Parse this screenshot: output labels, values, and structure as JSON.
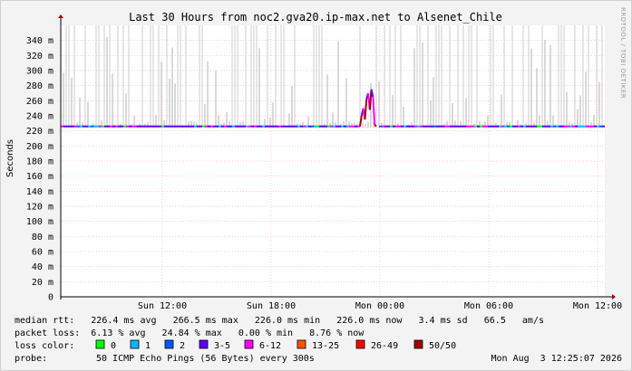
{
  "chart_data": {
    "type": "line",
    "title": "Last 30 Hours from noc2.gva20.ip-max.net to Alsenet_Chile",
    "ylabel": "Seconds",
    "side_label": "RRDTOOL / TOBI OETIKER",
    "ylim": [
      0,
      0.36
    ],
    "y_ticks": [
      {
        "label": "0",
        "value": 0
      },
      {
        "label": "20 m",
        "value": 0.02
      },
      {
        "label": "40 m",
        "value": 0.04
      },
      {
        "label": "60 m",
        "value": 0.06
      },
      {
        "label": "80 m",
        "value": 0.08
      },
      {
        "label": "100 m",
        "value": 0.1
      },
      {
        "label": "120 m",
        "value": 0.12
      },
      {
        "label": "140 m",
        "value": 0.14
      },
      {
        "label": "160 m",
        "value": 0.16
      },
      {
        "label": "180 m",
        "value": 0.18
      },
      {
        "label": "200 m",
        "value": 0.2
      },
      {
        "label": "220 m",
        "value": 0.22
      },
      {
        "label": "240 m",
        "value": 0.24
      },
      {
        "label": "260 m",
        "value": 0.26
      },
      {
        "label": "280 m",
        "value": 0.28
      },
      {
        "label": "300 m",
        "value": 0.3
      },
      {
        "label": "320 m",
        "value": 0.32
      },
      {
        "label": "340 m",
        "value": 0.34
      }
    ],
    "x_range_hours": [
      -30,
      0
    ],
    "x_ticks": [
      {
        "label": "Sun 12:00",
        "hours_ago": 24.4
      },
      {
        "label": "Sun 18:00",
        "hours_ago": 18.4
      },
      {
        "label": "Mon 00:00",
        "hours_ago": 12.4
      },
      {
        "label": "Mon 06:00",
        "hours_ago": 6.4
      },
      {
        "label": "Mon 12:00",
        "hours_ago": 0.4
      }
    ],
    "grid": true,
    "median_rtt_baseline": 0.226,
    "spike": {
      "start_hours_ago": 13.5,
      "end_hours_ago": 12.6,
      "values": [
        0.226,
        0.24,
        0.25,
        0.235,
        0.262,
        0.27,
        0.248,
        0.275,
        0.265,
        0.228,
        0.226
      ]
    },
    "loss_colors": [
      "#00ff00",
      "#00b8ff",
      "#0059ff",
      "#5e00ff",
      "#ff00ff",
      "#ff5500",
      "#ff0000",
      "#a10000"
    ]
  },
  "legend": {
    "median_rtt": "median rtt:   226.4 ms avg   266.5 ms max   226.0 ms min   226.0 ms now   3.4 ms sd   66.5   am/s",
    "packet_loss": "packet loss:  6.13 % avg   24.84 % max   0.00 % min   8.76 % now",
    "loss_color_label": "loss color:",
    "loss_items": [
      {
        "label": "0",
        "color": "#00ff00"
      },
      {
        "label": "1",
        "color": "#00b8ff"
      },
      {
        "label": "2",
        "color": "#0059ff"
      },
      {
        "label": "3-5",
        "color": "#5e00ff"
      },
      {
        "label": "6-12",
        "color": "#ff00ff"
      },
      {
        "label": "13-25",
        "color": "#ff5500"
      },
      {
        "label": "26-49",
        "color": "#ff0000"
      },
      {
        "label": "50/50",
        "color": "#a10000"
      }
    ],
    "probe_label": "probe:",
    "probe_text": "50 ICMP Echo Pings (56 Bytes) every 300s",
    "timestamp": "Mon Aug  3 12:25:07 2026"
  }
}
